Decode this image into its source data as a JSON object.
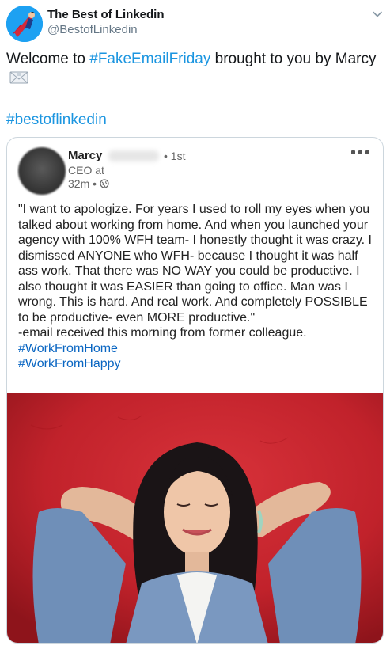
{
  "tweet": {
    "display_name": "The Best of Linkedin",
    "handle": "@BestofLinkedin",
    "text_prefix": "Welcome to ",
    "text_hashtag": "#FakeEmailFriday",
    "text_suffix": " brought to you by Marcy",
    "hashtag_line": "#bestoflinkedin"
  },
  "linkedin_post": {
    "author_name": "Marcy",
    "degree": "• 1st",
    "title": "CEO at",
    "time": "32m •",
    "body": "\"I want to apologize. For years I used to roll my eyes when you talked about working from home. And when you launched your agency with 100% WFH team- I honestly thought it was crazy. I dismissed ANYONE who WFH- because I thought it was half ass work. That there was NO WAY you could be productive. I also thought it was EASIER than going to office. Man was I wrong. This is hard. And real work. And completely POSSIBLE to be productive- even MORE productive.\"",
    "signoff": "-email received this morning from former colleague.",
    "hashtags": [
      "#WorkFromHome",
      "#WorkFromHappy"
    ]
  },
  "icons": {
    "caret": "chevron-down-icon",
    "email": "envelope-emoji-icon",
    "globe": "globe-icon",
    "more": "more-options-icon"
  },
  "colors": {
    "link": "#1b95e0",
    "linkedin_link": "#0a66c2",
    "photo_wall": "#c8222a"
  }
}
